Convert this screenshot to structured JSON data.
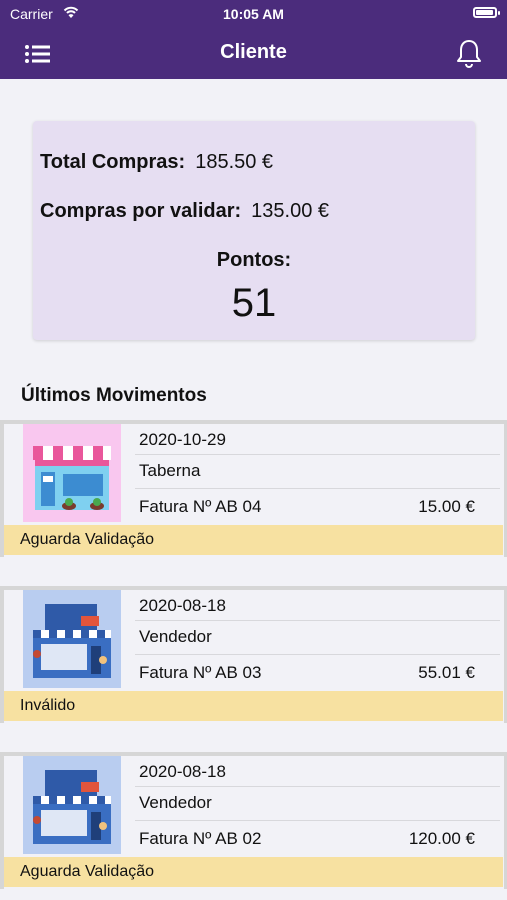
{
  "status_bar": {
    "carrier": "Carrier",
    "time": "10:05 AM",
    "battery_level": 0.95
  },
  "nav": {
    "title": "Cliente",
    "menu_icon": "menu-icon",
    "bell_icon": "bell-icon"
  },
  "summary": {
    "total_label": "Total Compras:",
    "total_value": "185.50 €",
    "pending_label": "Compras por validar:",
    "pending_value": "135.00 €",
    "points_label": "Pontos:",
    "points_value": "51"
  },
  "section_title": "Últimos Movimentos",
  "movements": [
    {
      "date": "2020-10-29",
      "merchant": "Taberna",
      "invoice": "Fatura Nº AB 04",
      "amount": "15.00 €",
      "status": "Aguarda Validação",
      "thumb": "pink-store"
    },
    {
      "date": "2020-08-18",
      "merchant": "Vendedor",
      "invoice": "Fatura Nº AB 03",
      "amount": "55.01 €",
      "status": "Inválido",
      "thumb": "blue-store"
    },
    {
      "date": "2020-08-18",
      "merchant": "Vendedor",
      "invoice": "Fatura Nº AB 02",
      "amount": "120.00 €",
      "status": "Aguarda Validação",
      "thumb": "blue-store"
    }
  ],
  "colors": {
    "header": "#4b2c7c",
    "summary_bg": "#e6def2",
    "status_bg": "#f7e1a1"
  }
}
